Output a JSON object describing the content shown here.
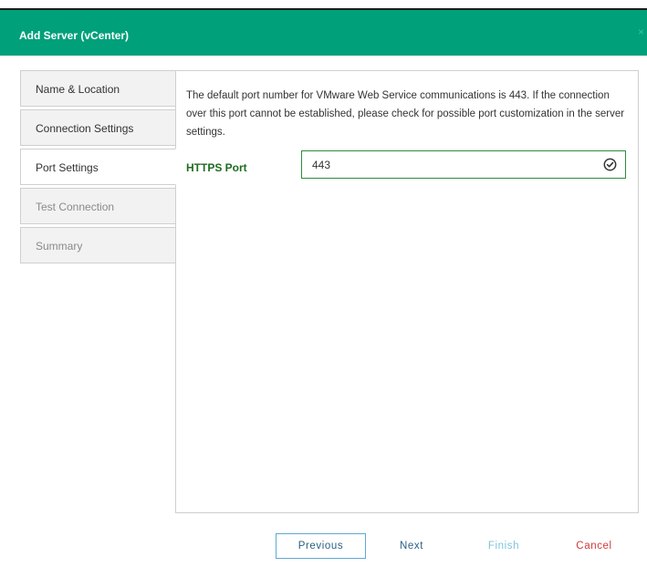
{
  "dialog": {
    "title": "Add Server (vCenter)",
    "close_glyph": "×"
  },
  "steps": [
    {
      "label": "Name & Location",
      "state": "done"
    },
    {
      "label": "Connection Settings",
      "state": "done"
    },
    {
      "label": "Port Settings",
      "state": "active"
    },
    {
      "label": "Test Connection",
      "state": "disabled"
    },
    {
      "label": "Summary",
      "state": "disabled"
    }
  ],
  "content": {
    "description": "The default port number for VMware Web Service communications is 443. If the connection over this port cannot be established, please check for possible port customization in the server settings.",
    "https_port": {
      "label": "HTTPS Port",
      "value": "443",
      "status_icon": "check-circle-icon",
      "valid_color": "#2f8a3e"
    }
  },
  "footer": {
    "previous": "Previous",
    "next": "Next",
    "finish": "Finish",
    "cancel": "Cancel"
  },
  "colors": {
    "header_bg": "#00a07a",
    "cancel": "#d23b3b",
    "link": "#2a5f84"
  }
}
